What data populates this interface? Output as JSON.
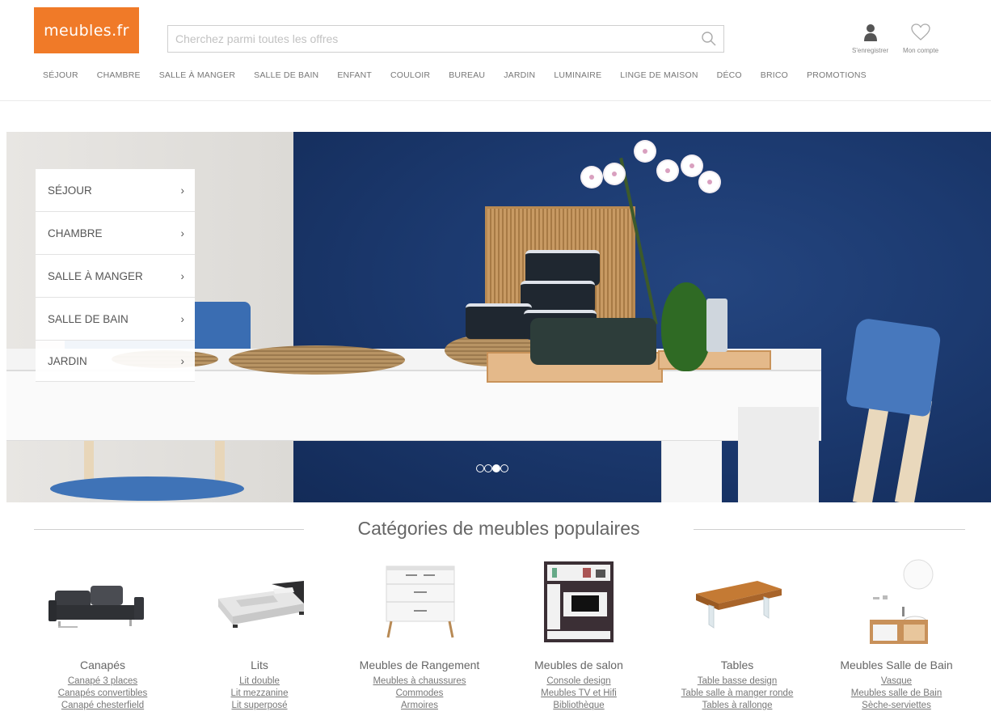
{
  "header": {
    "logo_text": "meubles.fr",
    "search_placeholder": "Cherchez parmi toutes les offres",
    "register_label": "S'enregistrer",
    "account_label": "Mon compte"
  },
  "nav": [
    "SÉJOUR",
    "CHAMBRE",
    "SALLE À MANGER",
    "SALLE DE BAIN",
    "ENFANT",
    "COULOIR",
    "BUREAU",
    "JARDIN",
    "LUMINAIRE",
    "LINGE DE MAISON",
    "DÉCO",
    "BRICO",
    "PROMOTIONS"
  ],
  "hero": {
    "menu": [
      "SÉJOUR",
      "CHAMBRE",
      "SALLE À MANGER",
      "SALLE DE BAIN",
      "JARDIN"
    ],
    "slide_count": 4,
    "active_slide": 3
  },
  "categories": {
    "title": "Catégories de meubles populaires",
    "items": [
      {
        "name": "Canapés",
        "links": [
          "Canapé 3 places",
          "Canapés convertibles",
          "Canapé chesterfield"
        ]
      },
      {
        "name": "Lits",
        "links": [
          "Lit double",
          "Lit mezzanine",
          "Lit superposé"
        ]
      },
      {
        "name": "Meubles de Rangement",
        "links": [
          "Meubles à chaussures",
          "Commodes",
          "Armoires"
        ]
      },
      {
        "name": "Meubles de salon",
        "links": [
          "Console design",
          "Meubles TV et Hifi",
          "Bibliothèque"
        ]
      },
      {
        "name": "Tables",
        "links": [
          "Table basse design",
          "Table salle à manger ronde",
          "Tables à rallonge"
        ]
      },
      {
        "name": "Meubles Salle de Bain",
        "links": [
          "Vasque",
          "Meubles salle de Bain",
          "Sèche-serviettes"
        ]
      }
    ]
  },
  "colors": {
    "brand": "#f07a28",
    "hero_wall": "#1c3a70"
  }
}
